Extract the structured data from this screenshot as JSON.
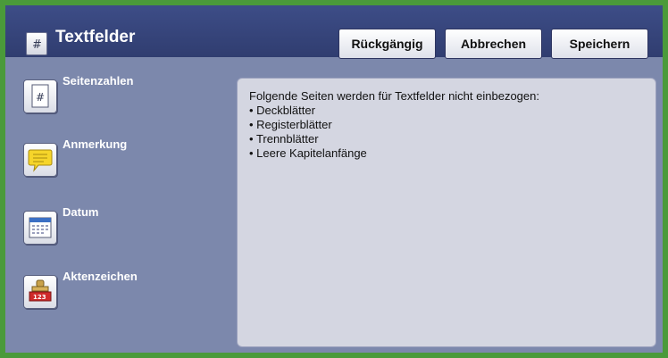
{
  "header": {
    "title": "Textfelder",
    "title_icon": "text-field-icon",
    "buttons": {
      "undo": "Rückgängig",
      "cancel": "Abbrechen",
      "save": "Speichern"
    }
  },
  "sidebar": {
    "items": [
      {
        "label": "Seitenzahlen",
        "icon": "page-number-icon"
      },
      {
        "label": "Anmerkung",
        "icon": "comment-icon"
      },
      {
        "label": "Datum",
        "icon": "calendar-icon"
      },
      {
        "label": "Aktenzeichen",
        "icon": "stamp-icon"
      }
    ]
  },
  "panel": {
    "intro": "Folgende Seiten werden für Textfelder nicht einbezogen:",
    "items": [
      "Deckblätter",
      "Registerblätter",
      "Trennblätter",
      "Leere Kapitelanfänge"
    ]
  },
  "colors": {
    "frame_border": "#4a9a3a",
    "header_bg": "#3d4d87",
    "body_bg": "#7c88ac",
    "panel_bg": "#d4d6e1"
  }
}
